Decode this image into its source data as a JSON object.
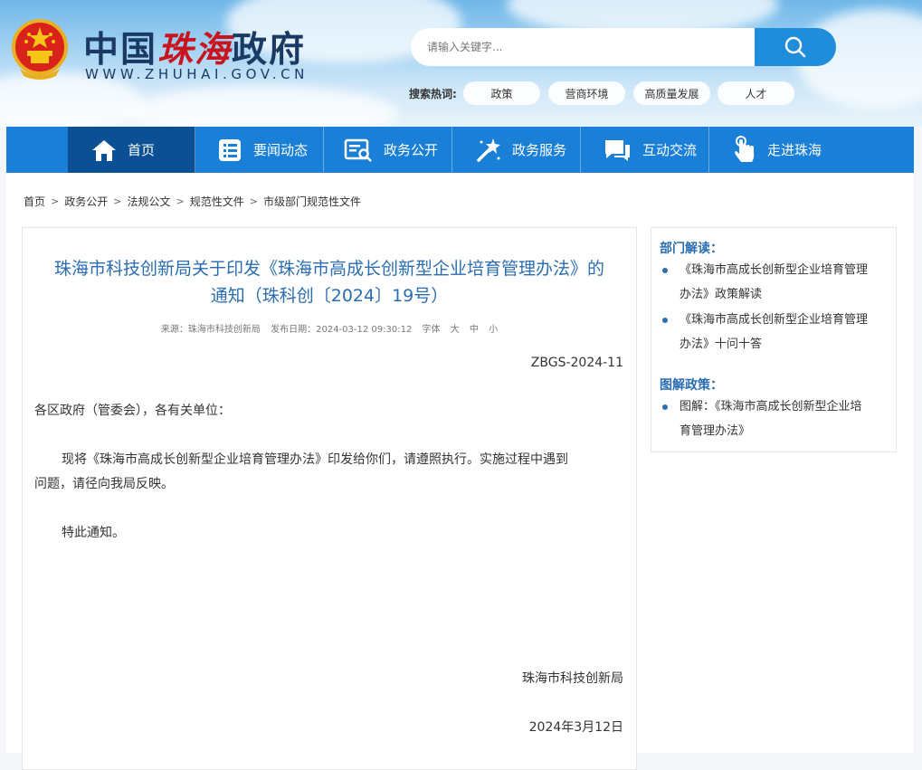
{
  "header": {
    "title_pre": "中国",
    "title_hl": "珠海",
    "title_post": "政府",
    "url": "WWW.ZHUHAI.GOV.CN",
    "search_placeholder": "请输入关键字...",
    "hot_label": "搜索热词:",
    "hot_tags": [
      "政策",
      "营商环境",
      "高质量发展",
      "人才"
    ]
  },
  "nav": {
    "items": [
      "首页",
      "要闻动态",
      "政务公开",
      "政务服务",
      "互动交流",
      "走进珠海"
    ]
  },
  "breadcrumb": [
    "首页",
    "政务公开",
    "法规公文",
    "规范性文件",
    "市级部门规范性文件"
  ],
  "article": {
    "title_line1": "珠海市科技创新局关于印发《珠海市高成长创新型企业培育管理办法》的",
    "title_line2": "通知（珠科创〔2024〕19号）",
    "source": "来源：珠海市科技创新局",
    "date": "发布日期：2024-03-12 09:30:12",
    "font_label": "字体",
    "font_sizes": [
      "大",
      "中",
      "小"
    ],
    "doc_no": "ZBGS-2024-11",
    "salutation": "各区政府（管委会），各有关单位：",
    "body_line1": "现将《珠海市高成长创新型企业培育管理办法》印发给你们，请遵照执行。实施过程中遇到",
    "body_line2": "问题，请径向我局反映。",
    "closing": "特此通知。",
    "signature": "珠海市科技创新局",
    "sign_date": "2024年3月12日"
  },
  "sidebar": {
    "section1_title": "部门解读：",
    "section1_items": [
      {
        "line1": "《珠海市高成长创新型企业培育管理",
        "line2": "办法》政策解读"
      },
      {
        "line1": "《珠海市高成长创新型企业培育管理",
        "line2": "办法》十问十答"
      }
    ],
    "section2_title": "图解政策：",
    "section2_items": [
      {
        "line1": "图解：《珠海市高成长创新型企业培",
        "line2": "育管理办法》"
      }
    ]
  },
  "colors": {
    "nav_bg": "#1a7fd6",
    "nav_active": "#0b4f94",
    "title_blue": "#2a6db0",
    "brand_red": "#c8151d"
  }
}
